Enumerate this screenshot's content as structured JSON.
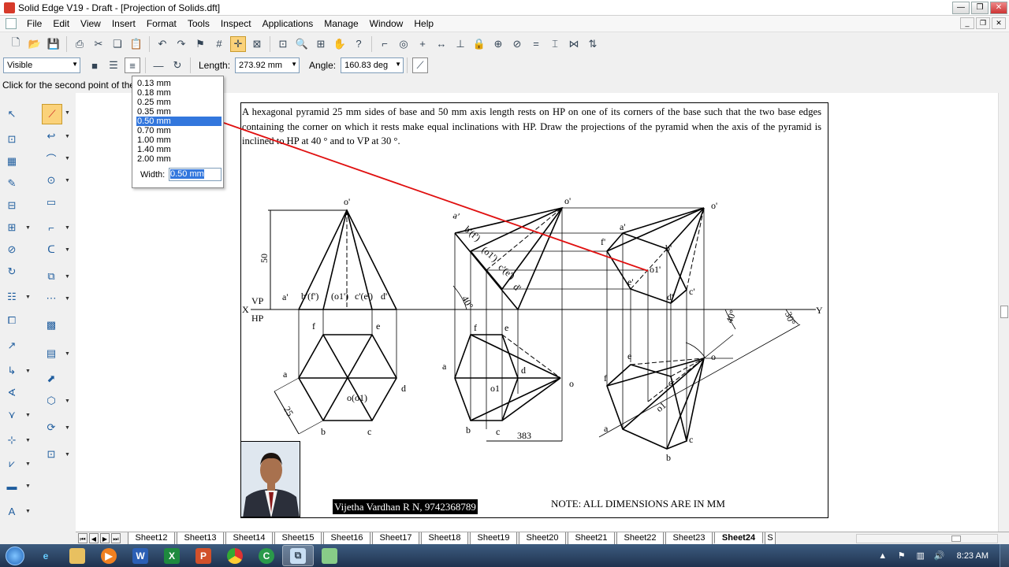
{
  "window": {
    "title": "Solid Edge V19 - Draft - [Projection of Solids.dft]"
  },
  "menubar": {
    "items": [
      "File",
      "Edit",
      "View",
      "Insert",
      "Format",
      "Tools",
      "Inspect",
      "Applications",
      "Manage",
      "Window",
      "Help"
    ]
  },
  "ribbon": {
    "line_style": "Visible",
    "length_label": "Length:",
    "length_value": "273.92 mm",
    "angle_label": "Angle:",
    "angle_value": "160.83 deg"
  },
  "status": {
    "prompt": "Click for the second point of the line"
  },
  "width_popup": {
    "options": [
      "0.13 mm",
      "0.18 mm",
      "0.25 mm",
      "0.35 mm",
      "0.50 mm",
      "0.70 mm",
      "1.00 mm",
      "1.40 mm",
      "2.00 mm"
    ],
    "selected": "0.50 mm",
    "width_label": "Width:",
    "width_value": "0.50 mm"
  },
  "drawing": {
    "problem_text": "A hexagonal pyramid 25 mm sides of base and 50 mm axis length rests on HP on one of its corners of the base such that the two base edges containing the corner on which it rests make equal inclinations with HP. Draw the projections of the pyramid when the axis of the pyramid is inclined to HP at 40 ° and to VP at 30 °.",
    "author": "Vijetha Vardhan R N, 9742368789",
    "note": "NOTE: ALL DIMENSIONS ARE IN MM",
    "labels": {
      "x": "X",
      "y": "Y",
      "vp": "VP",
      "hp": "HP",
      "dim50": "50",
      "dim25": "25",
      "dim383": "383",
      "ang40a": "40°",
      "ang40b": "40°",
      "ang30": "30°",
      "v1_o": "o'",
      "v1_a": "a'",
      "v1_bf": "b'(f')",
      "v1_o1": "(o1')",
      "v1_ce": "c'(e')",
      "v1_d": "d'",
      "t1_f": "f",
      "t1_e": "e",
      "t1_a": "a",
      "t1_d": "d",
      "t1_o": "o(o1)",
      "t1_b": "b",
      "t1_c": "c",
      "v2_a": "a'",
      "v2_o": "o'",
      "v2_bf": "b'(f')",
      "v2_o1": "(o1')",
      "v2_ce": "c'(e')",
      "v2_d": "d'",
      "t2_f": "f",
      "t2_e": "e",
      "t2_a": "a",
      "t2_d": "d",
      "t2_o1": "o1",
      "t2_o": "o",
      "t2_b": "b",
      "t2_c": "c",
      "v3_o": "o'",
      "v3_a": "a'",
      "v3_f": "f'",
      "v3_b": "b'",
      "v3_o1": "o1'",
      "v3_e": "e'",
      "v3_d": "d'",
      "v3_c": "c'",
      "t3_f": "f",
      "t3_e": "e",
      "t3_d": "d",
      "t3_o1": "o1",
      "t3_a": "a",
      "t3_c": "c",
      "t3_b": "b",
      "t3_o": "o"
    }
  },
  "sheet_tabs": {
    "tabs": [
      "Sheet12",
      "Sheet13",
      "Sheet14",
      "Sheet15",
      "Sheet16",
      "Sheet17",
      "Sheet18",
      "Sheet19",
      "Sheet20",
      "Sheet21",
      "Sheet22",
      "Sheet23",
      "Sheet24",
      "S"
    ],
    "active": "Sheet24"
  },
  "taskbar": {
    "clock": "8:23 AM",
    "apps": [
      "IE",
      "Explorer",
      "Media",
      "W",
      "X",
      "P",
      "Chrome",
      "Cam",
      "SolidEdge",
      "Sticky"
    ]
  },
  "colors": {
    "construction_line": "#e01010",
    "selection": "#3377dd",
    "active_tool": "#fbd27a"
  }
}
